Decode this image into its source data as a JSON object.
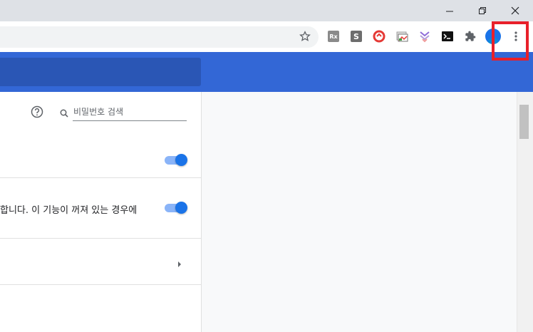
{
  "window_controls": {
    "minimize": "minimize",
    "restore": "restore",
    "close": "close"
  },
  "toolbar": {
    "bookmark_icon": "star-icon",
    "extensions": [
      {
        "name": "ext-rx",
        "label": "Rx",
        "color": "#8a8a8a"
      },
      {
        "name": "ext-s",
        "label": "S",
        "color": "#6d6d6d"
      },
      {
        "name": "ext-red-circle",
        "label": "",
        "color": "#e53935"
      },
      {
        "name": "ext-image",
        "label": "",
        "color": "#9e9e9e"
      },
      {
        "name": "ext-purple",
        "label": "",
        "color": "#8e6ad8"
      },
      {
        "name": "ext-terminal",
        "label": "",
        "color": "#111111"
      }
    ],
    "puzzle_icon": "puzzle-icon",
    "avatar_color": "#1a73e8",
    "menu_icon": "three-dots-vertical-icon"
  },
  "password_search": {
    "help_icon": "help-circle-icon",
    "placeholder": "비밀번호 검색"
  },
  "settings": [
    {
      "text": "",
      "toggle_on": true
    },
    {
      "text": "합니다. 이 기능이 꺼져 있는 경우에",
      "toggle_on": true
    },
    {
      "text": "",
      "arrow": "chevron-right-icon"
    }
  ],
  "colors": {
    "header_blue": "#3367d6",
    "highlight_red": "#e8202a",
    "toggle_blue": "#1a73e8"
  }
}
